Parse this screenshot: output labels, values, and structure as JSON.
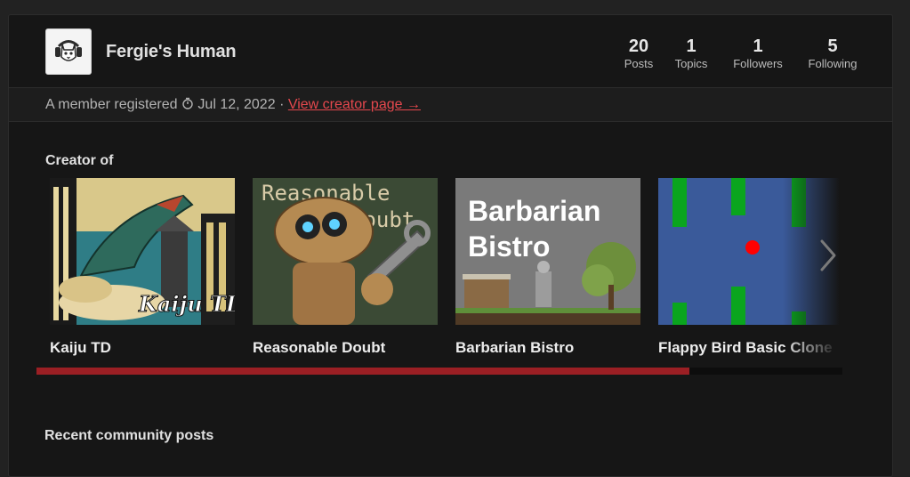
{
  "profile": {
    "name": "Fergie's Human",
    "stats": [
      {
        "num": "20",
        "label": "Posts"
      },
      {
        "num": "1",
        "label": "Topics"
      },
      {
        "num": "1",
        "label": "Followers"
      },
      {
        "num": "5",
        "label": "Following"
      }
    ]
  },
  "member": {
    "prefix": "A member registered",
    "date": "Jul 12, 2022",
    "separator": "·",
    "link": "View creator page →"
  },
  "creator_of": {
    "title": "Creator of",
    "games": [
      {
        "title": "Kaiju TD",
        "thumb_text": "Kaiju TD"
      },
      {
        "title": "Reasonable Doubt",
        "thumb_text": "Reasonable Doubt"
      },
      {
        "title": "Barbarian Bistro",
        "thumb_text": "Barbarian Bistro"
      },
      {
        "title": "Flappy Bird Basic Clone"
      }
    ],
    "scroll_progress": 0.81
  },
  "recent": {
    "title": "Recent community posts"
  },
  "colors": {
    "accent": "#e5484d",
    "scrollbar": "#9b1f24",
    "panel": "#161616"
  }
}
